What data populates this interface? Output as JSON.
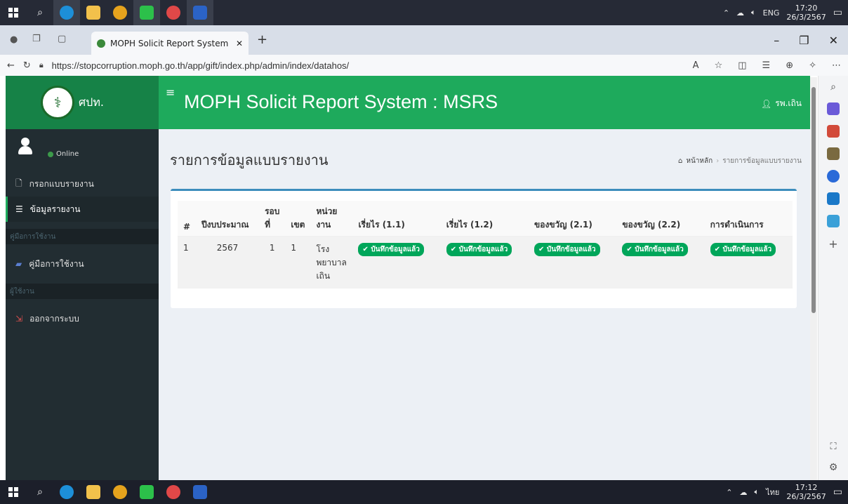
{
  "os": {
    "top_clock_time": "17:20",
    "top_clock_date": "26/3/2567",
    "top_lang": "ENG",
    "bottom_clock_time": "17:12",
    "bottom_clock_date": "26/3/2567",
    "bottom_lang": "ไทย"
  },
  "browser": {
    "tab_title": "MOPH Solicit Report System : MS",
    "url": "https://stopcorruption.moph.go.th/app/gift/index.php/admin/index/datahos/"
  },
  "header": {
    "brand_text": "ศปท.",
    "system_title": "MOPH Solicit Report System : MSRS",
    "user_label": "รพ.เถิน"
  },
  "sidebar": {
    "status": "Online",
    "items": [
      {
        "label": "กรอกแบบรายงาน"
      },
      {
        "label": "ข้อมูลรายงาน"
      }
    ],
    "header_manual": "คู่มือการใช้งาน",
    "manual_item": "คู่มือการใช้งาน",
    "header_user": "ผู้ใช้งาน",
    "logout": "ออกจากระบบ"
  },
  "content": {
    "title": "รายการข้อมูลแบบรายงาน",
    "breadcrumb_home": "หน้าหลัก",
    "breadcrumb_current": "รายการข้อมูลแบบรายงาน"
  },
  "table": {
    "headers": [
      "#",
      "ปีงบประมาณ",
      "รอบที่",
      "เขต",
      "หน่วยงาน",
      "เรี่ยไร (1.1)",
      "เรี่ยไร (1.2)",
      "ของขวัญ (2.1)",
      "ของขวัญ (2.2)",
      "การดำเนินการ"
    ],
    "rows": [
      {
        "no": "1",
        "year": "2567",
        "round": "1",
        "zone": "1",
        "unit": "โรงพยาบาลเถิน",
        "s11": "✔ บันทึกข้อมูลแล้ว",
        "s12": "✔ บันทึกข้อมูลแล้ว",
        "s21": "✔ บันทึกข้อมูลแล้ว",
        "s22": "✔ บันทึกข้อมูลแล้ว",
        "action": "✔ บันทึกข้อมูลแล้ว"
      }
    ]
  },
  "colors": {
    "brand_green": "#168247",
    "header_green": "#1eaa5c",
    "sidebar_dark": "#222d32",
    "badge_green": "#00a65a",
    "box_border_blue": "#3c8dbc"
  }
}
